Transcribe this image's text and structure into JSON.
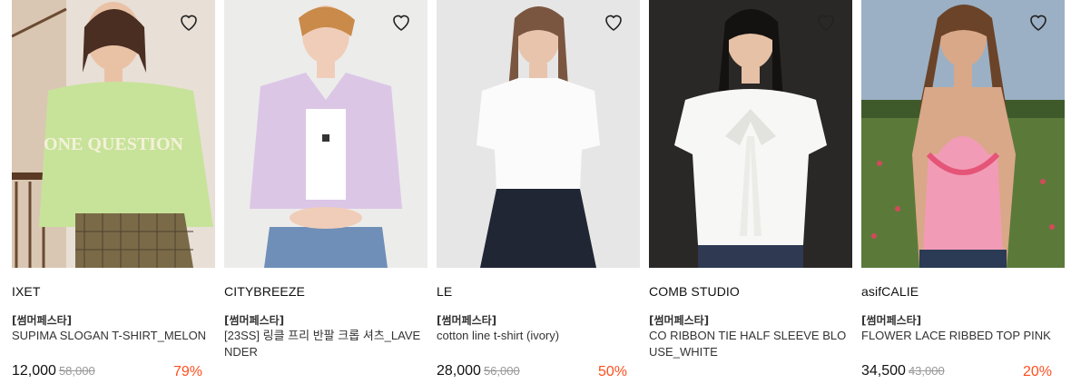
{
  "products": [
    {
      "brand": "IXET",
      "tag": "[썸머페스타]",
      "name": "SUPIMA SLOGAN T-SHIRT_MELON",
      "price": "12,000",
      "original_price": "58,000",
      "discount": "79%",
      "icon": "heart-outline-icon"
    },
    {
      "brand": "CITYBREEZE",
      "tag": "[썸머페스타]",
      "name": "[23SS] 링클 프리 반팔 크롭 셔츠_LAVENDER",
      "price": "",
      "original_price": "",
      "discount": "",
      "icon": "heart-outline-icon"
    },
    {
      "brand": "LE",
      "tag": "[썸머페스타]",
      "name": "cotton line t-shirt (ivory)",
      "price": "28,000",
      "original_price": "56,000",
      "discount": "50%",
      "icon": "heart-outline-icon"
    },
    {
      "brand": "COMB STUDIO",
      "tag": "[썸머페스타]",
      "name": "CO RIBBON TIE HALF SLEEVE BLOUSE_WHITE",
      "price": "",
      "original_price": "",
      "discount": "",
      "icon": "heart-outline-icon"
    },
    {
      "brand": "asifCALIE",
      "tag": "[썸머페스타]",
      "name": "FLOWER LACE RIBBED TOP PINK",
      "price": "34,500",
      "original_price": "43,000",
      "discount": "20%",
      "icon": "heart-outline-icon"
    }
  ],
  "colors": {
    "discount": "#ff4f1f",
    "original_price": "#999999",
    "text": "#111111"
  }
}
